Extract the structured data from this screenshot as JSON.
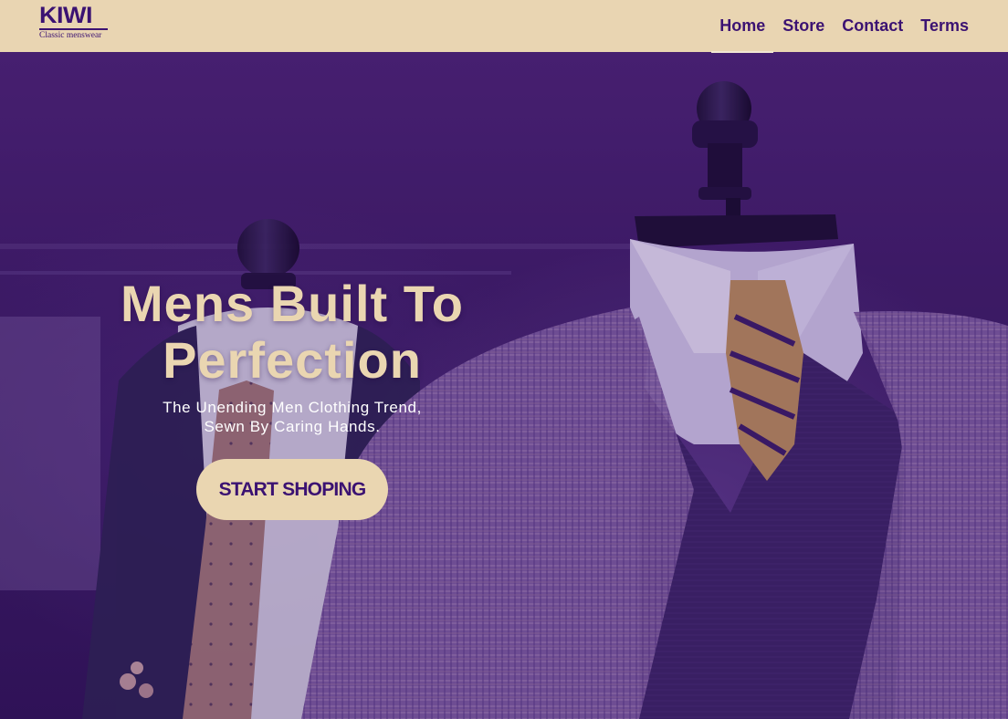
{
  "brand": {
    "name": "KIWI",
    "tagline": "Classic menswear"
  },
  "nav": {
    "items": [
      {
        "label": "Home",
        "active": true
      },
      {
        "label": "Store",
        "active": false
      },
      {
        "label": "Contact",
        "active": false
      },
      {
        "label": "Terms",
        "active": false
      }
    ]
  },
  "hero": {
    "title": "Mens Built To Perfection",
    "subtitle": "The Unending Men Clothing Trend, Sewn By Caring Hands.",
    "cta_label": "START SHOPING",
    "image_subject": "suit-mannequins"
  },
  "colors": {
    "header_bg": "#e9d5b2",
    "brand_purple": "#3b1272",
    "hero_overlay": "#3b1a66",
    "accent_cream": "#ead6b1"
  }
}
